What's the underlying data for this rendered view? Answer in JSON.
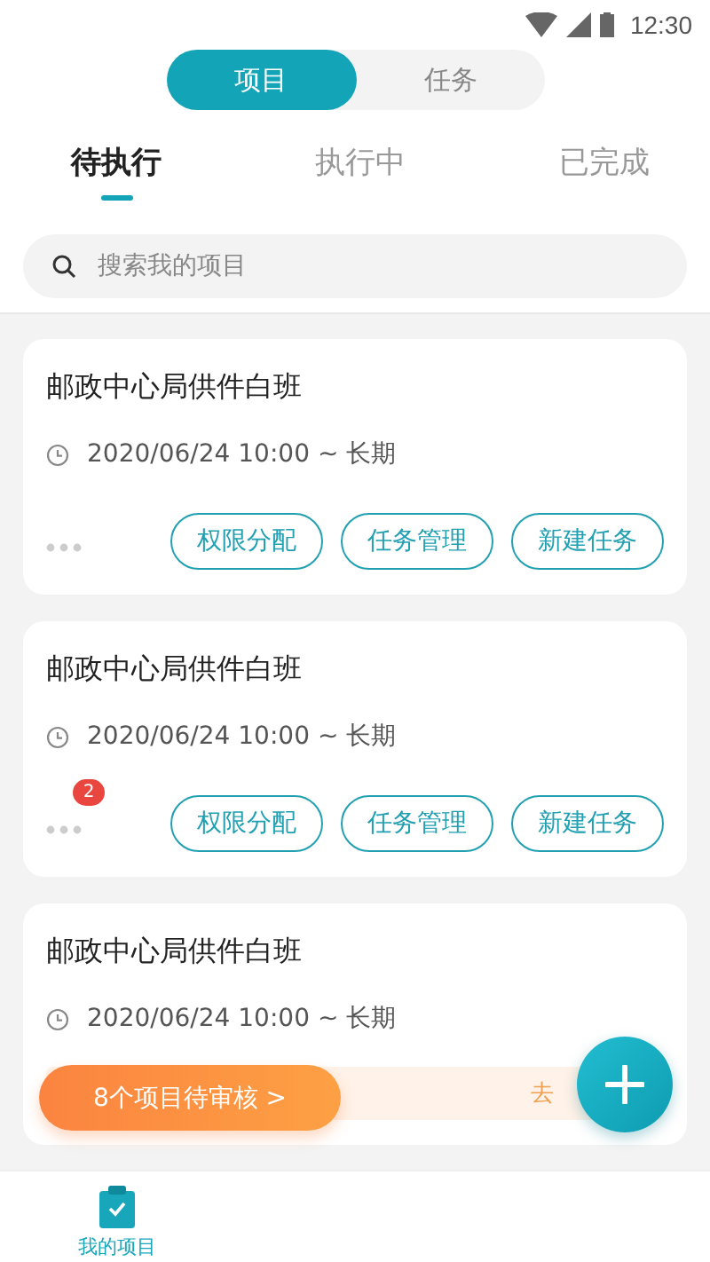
{
  "status_bar": {
    "time": "12:30"
  },
  "segments": [
    {
      "label": "项目",
      "selected": true
    },
    {
      "label": "任务",
      "selected": false
    }
  ],
  "tabs": [
    {
      "label": "待执行",
      "selected": true
    },
    {
      "label": "执行中",
      "selected": false
    },
    {
      "label": "已完成",
      "selected": false
    }
  ],
  "search": {
    "placeholder": "搜索我的项目"
  },
  "projects": [
    {
      "title": "邮政中心局供件白班",
      "time": "2020/06/24 10:00 ~ 长期",
      "buttons": [
        "权限分配",
        "任务管理",
        "新建任务"
      ]
    },
    {
      "title": "邮政中心局供件白班",
      "time": "2020/06/24 10:00 ~ 长期",
      "badge": "2",
      "buttons": [
        "权限分配",
        "任务管理",
        "新建任务"
      ]
    },
    {
      "title": "邮政中心局供件白班",
      "time": "2020/06/24 10:00 ~ 长期",
      "banner": {
        "action": "去"
      }
    }
  ],
  "review_pill": "8个项目待审核 >",
  "bottom_nav": [
    {
      "label": "我的项目",
      "selected": true
    }
  ]
}
